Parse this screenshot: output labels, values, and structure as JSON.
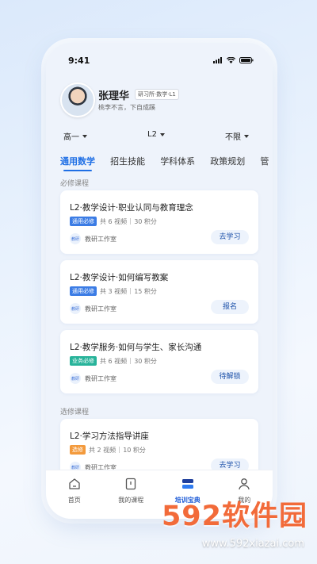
{
  "status": {
    "time": "9:41"
  },
  "user": {
    "name": "张理华",
    "badge": "研习所·数学·L1",
    "motto": "桃李不言，下自成蹊"
  },
  "filters": [
    {
      "label": "高一"
    },
    {
      "label": "L2"
    },
    {
      "label": "不限"
    }
  ],
  "tabs": [
    {
      "label": "通用数学"
    },
    {
      "label": "招生技能"
    },
    {
      "label": "学科体系"
    },
    {
      "label": "政策规划"
    },
    {
      "label": "管"
    }
  ],
  "sections": {
    "required": "必修课程",
    "elective": "选修课程"
  },
  "courses": [
    {
      "title": "L2·教学设计·职业认同与教育理念",
      "tag": "通用必修",
      "tag_color": "#3b7ce5",
      "videos": "共 6 视频",
      "points": "30 积分",
      "org": "教研工作室",
      "org_icon": "教研",
      "action": "去学习"
    },
    {
      "title": "L2·教学设计·如何编写教案",
      "tag": "通用必修",
      "tag_color": "#3b7ce5",
      "videos": "共 3 视频",
      "points": "15 积分",
      "org": "教研工作室",
      "org_icon": "教研",
      "action": "报名"
    },
    {
      "title": "L2·教学服务·如何与学生、家长沟通",
      "tag": "业务必修",
      "tag_color": "#27b39a",
      "videos": "共 6 视频",
      "points": "30 积分",
      "org": "教研工作室",
      "org_icon": "教研",
      "action": "待解锁"
    },
    {
      "title": "L2·学习方法指导讲座",
      "tag": "选修",
      "tag_color": "#f39a3c",
      "videos": "共 2 视频",
      "points": "10 积分",
      "org": "教研工作室",
      "org_icon": "教研",
      "action": "去学习"
    }
  ],
  "tabbar": [
    {
      "label": "首页",
      "icon": "home-icon"
    },
    {
      "label": "我的课程",
      "icon": "book-icon"
    },
    {
      "label": "培训宝典",
      "icon": "training-icon"
    },
    {
      "label": "我的",
      "icon": "profile-icon"
    }
  ],
  "watermark": {
    "brand": "592软件园",
    "url": "www.592xiazai.com"
  },
  "colors": {
    "accent": "#1f6fe5",
    "button_bg": "#edf3fc"
  }
}
